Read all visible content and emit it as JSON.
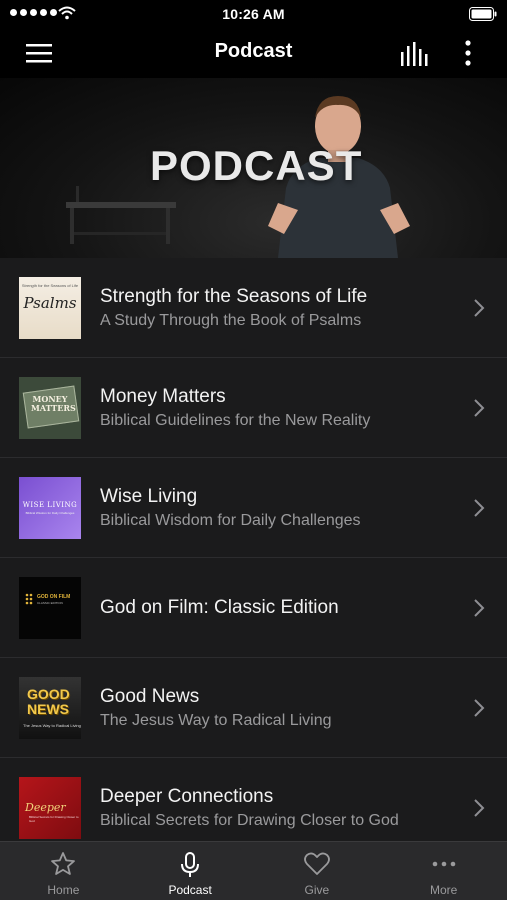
{
  "status_bar": {
    "time": "10:26 AM"
  },
  "nav": {
    "title": "Podcast"
  },
  "hero": {
    "text": "PODCAST"
  },
  "podcasts": [
    {
      "title": "Strength for the Seasons of Life",
      "subtitle": "A Study Through the Book of Psalms",
      "thumb_text": "Psalms",
      "thumb_top": "Strength for the Seasons of Life"
    },
    {
      "title": "Money Matters",
      "subtitle": "Biblical Guidelines for the New Reality",
      "thumb_text": "MONEY MATTERS"
    },
    {
      "title": "Wise Living",
      "subtitle": "Biblical Wisdom for Daily Challenges",
      "thumb_text": "WISE LIVING",
      "thumb_sub": "Biblical Wisdom for Daily Challenges"
    },
    {
      "title": "God on Film: Classic Edition",
      "subtitle": "",
      "thumb_text": "GOD ON FILM",
      "thumb_sub": "CLASSIC EDITION"
    },
    {
      "title": "Good News",
      "subtitle": "The Jesus Way to Radical Living",
      "thumb_text": "GOOD NEWS",
      "thumb_sub": "The Jesus Way to Radical Living"
    },
    {
      "title": "Deeper Connections",
      "subtitle": "Biblical Secrets for Drawing Closer to God",
      "thumb_text": "Deeper",
      "thumb_sub": "Biblical Secrets for Drawing Closer to God"
    }
  ],
  "tabs": [
    {
      "label": "Home",
      "icon": "star-icon"
    },
    {
      "label": "Podcast",
      "icon": "microphone-icon",
      "active": true
    },
    {
      "label": "Give",
      "icon": "heart-icon"
    },
    {
      "label": "More",
      "icon": "more-horizontal-icon"
    }
  ],
  "colors": {
    "background": "#000000",
    "list_background": "#1b1b1c",
    "tab_bar": "#2a2a2c",
    "subtitle": "#9a9a9c"
  }
}
